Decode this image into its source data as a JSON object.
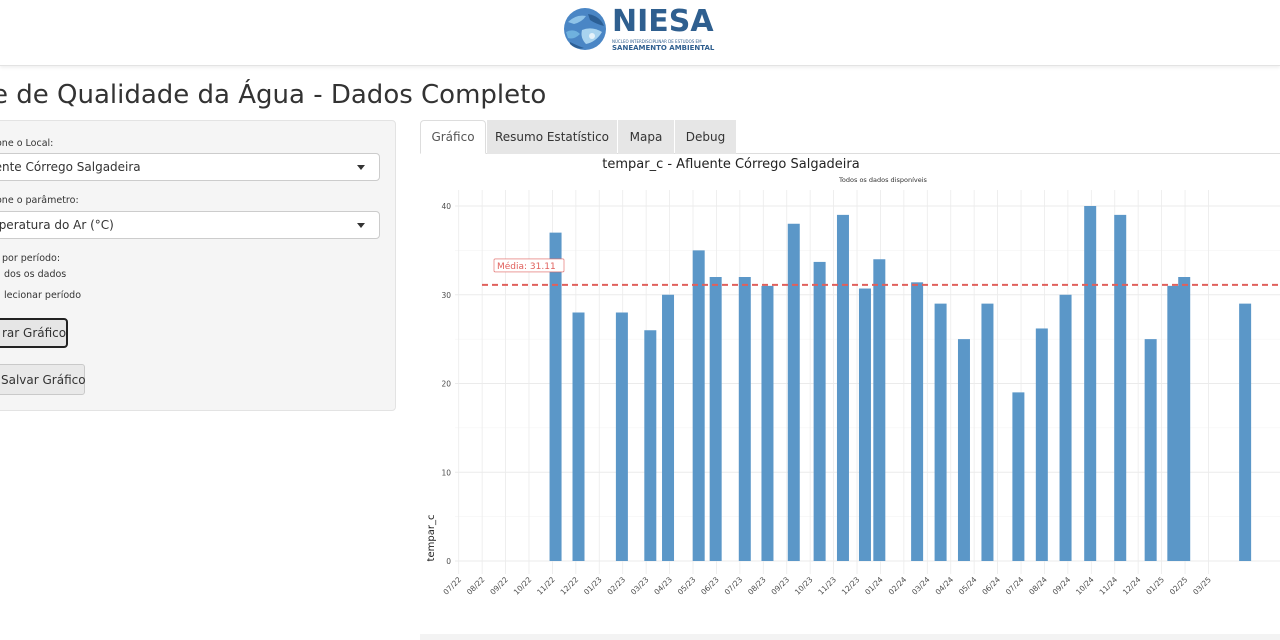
{
  "header": {
    "logo_word": "NIESA",
    "logo_sub1": "NÚCLEO INTERDISCIPLINAR DE ESTUDOS EM",
    "logo_sub2": "SANEAMENTO AMBIENTAL"
  },
  "page_title": "lise de Qualidade da Água - Dados Completo",
  "sidebar": {
    "local_label": "one o Local:",
    "local_value": "uente Córrego Salgadeira",
    "param_label": "one o parâmetro:",
    "param_value": "mperatura do Ar (°C)",
    "period_label": "por período:",
    "period_options": [
      "dos os dados",
      "lecionar período"
    ],
    "generate_button": "rar Gráfico",
    "save_button": "Salvar Gráfico"
  },
  "tabs": [
    {
      "label": "Gráfico",
      "active": true
    },
    {
      "label": "Resumo Estatístico",
      "active": false
    },
    {
      "label": "Mapa",
      "active": false
    },
    {
      "label": "Debug",
      "active": false
    }
  ],
  "colors": {
    "bar": "#5b97c8",
    "mean_line": "#e0605c",
    "grid": "#ebebeb"
  },
  "chart_data": {
    "type": "bar",
    "title": "tempar_c - Afluente Córrego Salgadeira",
    "subtitle": "Todos os dados disponíveis",
    "ylabel": "tempar_c",
    "xlabel": "",
    "ylim": [
      0,
      40
    ],
    "y_ticks": [
      0,
      10,
      20,
      30,
      40
    ],
    "x_tick_labels": [
      "07/22",
      "08/22",
      "09/22",
      "10/22",
      "11/22",
      "12/22",
      "01/23",
      "02/23",
      "03/23",
      "04/23",
      "05/23",
      "06/23",
      "07/23",
      "08/23",
      "09/23",
      "10/23",
      "11/23",
      "12/23",
      "01/24",
      "02/24",
      "03/24",
      "04/24",
      "05/24",
      "06/24",
      "07/24",
      "08/24",
      "09/24",
      "10/24",
      "11/24",
      "12/24",
      "01/25",
      "02/25",
      "03/25"
    ],
    "mean": 31.11,
    "mean_label": "Média: 31.11",
    "grid": true,
    "bars": [
      {
        "date": "2022-11-20",
        "value": 37
      },
      {
        "date": "2022-12-20",
        "value": 28
      },
      {
        "date": "2023-02-14",
        "value": 28
      },
      {
        "date": "2023-03-22",
        "value": 26
      },
      {
        "date": "2023-04-14",
        "value": 30
      },
      {
        "date": "2023-05-24",
        "value": 35
      },
      {
        "date": "2023-06-15",
        "value": 32
      },
      {
        "date": "2023-07-23",
        "value": 32
      },
      {
        "date": "2023-08-22",
        "value": 31
      },
      {
        "date": "2023-09-25",
        "value": 38
      },
      {
        "date": "2023-10-29",
        "value": 33.7
      },
      {
        "date": "2023-11-28",
        "value": 39
      },
      {
        "date": "2023-12-27",
        "value": 30.7
      },
      {
        "date": "2024-01-15",
        "value": 34
      },
      {
        "date": "2024-03-03",
        "value": 31.4
      },
      {
        "date": "2024-04-03",
        "value": 29
      },
      {
        "date": "2024-05-03",
        "value": 25
      },
      {
        "date": "2024-06-03",
        "value": 29
      },
      {
        "date": "2024-07-13",
        "value": 19
      },
      {
        "date": "2024-08-13",
        "value": 26.2
      },
      {
        "date": "2024-09-13",
        "value": 30
      },
      {
        "date": "2024-10-15",
        "value": 40
      },
      {
        "date": "2024-11-23",
        "value": 39
      },
      {
        "date": "2025-01-02",
        "value": 25
      },
      {
        "date": "2025-02-01",
        "value": 31
      },
      {
        "date": "2025-02-14",
        "value": 32
      },
      {
        "date": "2025-05-03",
        "value": 29
      }
    ]
  }
}
